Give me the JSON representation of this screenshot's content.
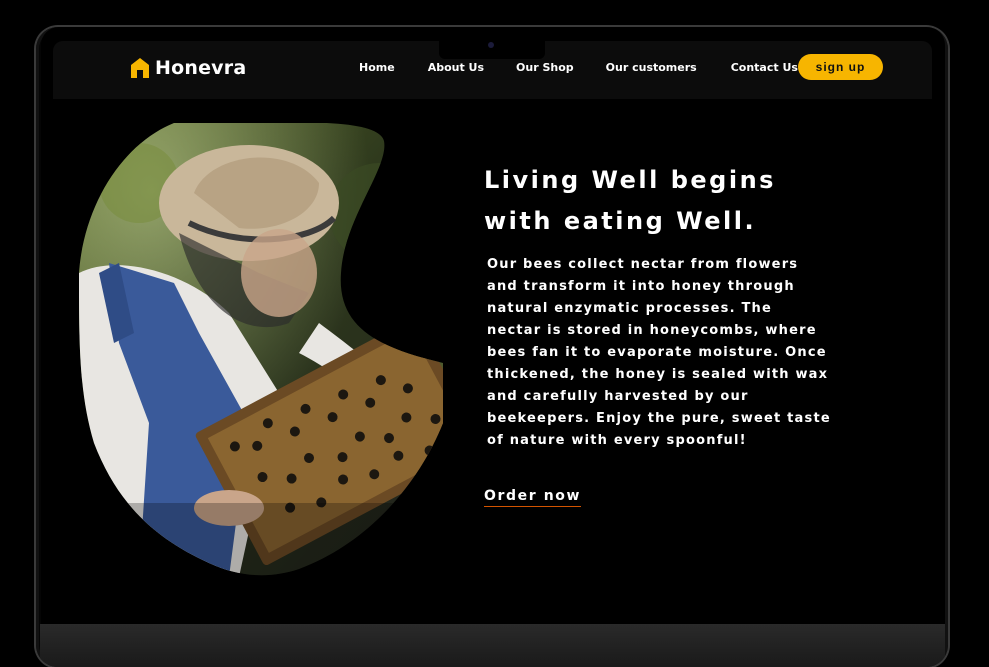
{
  "brand": {
    "name": "Honevra",
    "accent": "#f7b500"
  },
  "nav": {
    "items": [
      {
        "label": "Home"
      },
      {
        "label": "About Us"
      },
      {
        "label": "Our Shop"
      },
      {
        "label": "Our customers"
      },
      {
        "label": "Contact Us"
      }
    ],
    "signup_label": "sign up"
  },
  "hero": {
    "headline_line1": "Living Well begins",
    "headline_line2": "with eating Well.",
    "paragraph": "Our bees collect nectar from flowers and transform it into honey through natural enzymatic processes. The nectar is stored in honeycombs, where bees fan it to evaporate moisture. Once thickened, the honey is sealed with wax and carefully harvested by our beekeepers. Enjoy the pure, sweet taste of nature with every spoonful!",
    "cta_label": "Order now",
    "cta_underline_color": "#d35400"
  },
  "icons": {
    "brand_icon": "house-icon"
  }
}
